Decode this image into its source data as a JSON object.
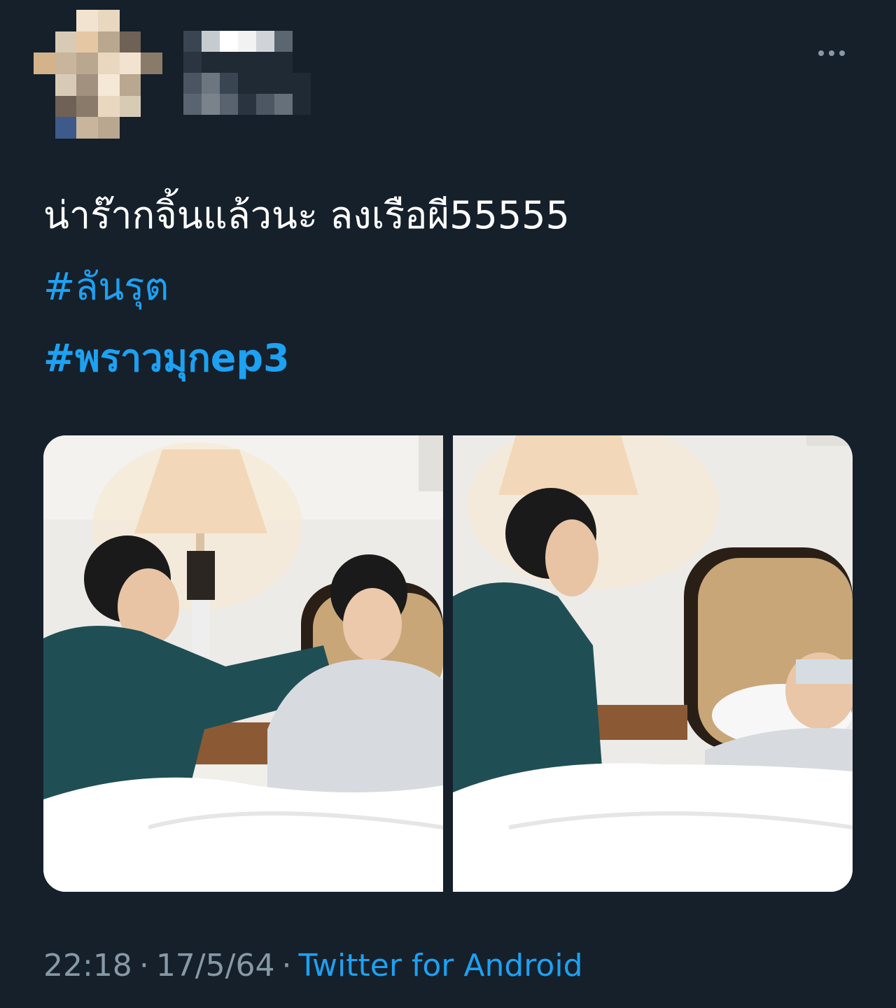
{
  "author": {
    "display_name": "",
    "handle": "",
    "avatar_colors": [
      "#d8cbb6",
      "#e9d7c0",
      "#b9a78f",
      "#f2e3d0",
      "#c9b59c",
      "#8a7a6a",
      "#e6c7a4",
      "#a2917f",
      "#d4b28a",
      "#6f6155",
      "#f6e8d6",
      "#3d5a8a"
    ]
  },
  "menu": {
    "more_icon": "more-horizontal-icon"
  },
  "tweet": {
    "text": "น่าร๊ากจิ้นแล้วนะ ลงเรือผี55555",
    "hashtags": [
      "#ลันรุต",
      "#พราวมุกep3"
    ]
  },
  "media": {
    "images": [
      {
        "icon": "photo-icon"
      },
      {
        "icon": "photo-icon"
      }
    ]
  },
  "meta": {
    "time": "22:18",
    "date": "17/5/64",
    "separator": "·",
    "source": "Twitter for Android"
  },
  "colors": {
    "background": "#15202b",
    "text": "#ffffff",
    "link": "#1da1f2",
    "secondary": "#8899a6"
  }
}
